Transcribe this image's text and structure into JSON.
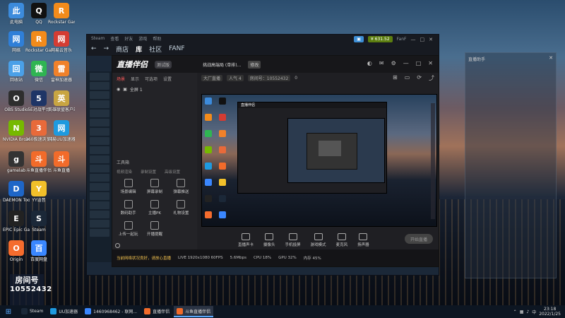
{
  "desktop": {
    "icons": [
      {
        "label": "此电脑",
        "color": "#3c8bdc"
      },
      {
        "label": "QQ",
        "color": "#111111"
      },
      {
        "label": "Rockstar Games Launcher",
        "color": "#f28b1b"
      },
      {
        "label": "网络",
        "color": "#2f7fd8"
      },
      {
        "label": "Rockstar Games Social Club",
        "color": "#f28b1b"
      },
      {
        "label": "网易云音乐",
        "color": "#d43c33"
      },
      {
        "label": "回收站",
        "color": "#4aa0e8"
      },
      {
        "label": "微信",
        "color": "#2fb552"
      },
      {
        "label": "雷神加速器",
        "color": "#f0812a"
      },
      {
        "label": "OBS Studio",
        "color": "#2e2e2e"
      },
      {
        "label": "5E对战平台",
        "color": "#1e3566"
      },
      {
        "label": "英雄联盟客户端",
        "color": "#c8a542"
      },
      {
        "label": "NVIDIA Broadcast",
        "color": "#76b900"
      },
      {
        "label": "360极速浏览器",
        "color": "#e86a3a"
      },
      {
        "label": "网易UU加速器",
        "color": "#1e9adf"
      },
      {
        "label": "gamelab",
        "color": "#333333"
      },
      {
        "label": "斗鱼直播伴侣",
        "color": "#f26b2a"
      },
      {
        "label": "斗鱼直播",
        "color": "#f26b2a"
      },
      {
        "label": "DAEMON Tools Lite",
        "color": "#1e66c8"
      },
      {
        "label": "YY语音",
        "color": "#f2c02a"
      },
      {
        "label": "EPIC Epic Games Launcher",
        "color": "#222222"
      },
      {
        "label": "Steam",
        "color": "#1b2838"
      },
      {
        "label": "Origin",
        "color": "#f56c2d"
      },
      {
        "label": "百度网盘",
        "color": "#3a87ff"
      }
    ],
    "room_badge": {
      "line1": "房间号",
      "line2": "10552432"
    }
  },
  "steam": {
    "menu": [
      "Steam",
      "查看",
      "好友",
      "游戏",
      "帮助"
    ],
    "nav": [
      "商店",
      "库",
      "社区",
      "FANF"
    ],
    "active_nav": "库",
    "user": "FanF",
    "balance": "¥ 631.52"
  },
  "live_app": {
    "logo": "直播伴侣",
    "version": "测试版",
    "stream_title": "挑战高端局 (单排)...",
    "title_tag": "修改",
    "info_chips": [
      "大厂直播",
      "人气 4",
      "房间号：10552432",
      "0"
    ],
    "tabs": [
      "场景",
      "显示",
      "可选项",
      "设置"
    ],
    "scene": "全屏 1",
    "tools_label": "工具箱",
    "tools_row": [
      "视频渲染",
      "录制设置",
      "高级设置"
    ],
    "tools": [
      "场景编辑",
      "屏幕录制",
      "弹幕推送",
      "数码助手",
      "主播PK",
      "礼物设置",
      "上传一起玩",
      "开播提醒",
      ""
    ],
    "bottom_buttons": [
      "直播声卡",
      "摄像头",
      "手机投屏",
      "游戏模式",
      "麦克风",
      "扬声器"
    ],
    "start_button": "开始直播",
    "status_items": [
      "LIVE 1920x1080 60FPS",
      "5.6Mbps",
      "CPU 18%",
      "GPU 32%",
      "内存 45%"
    ],
    "status_warn": "当前网络状况良好，请放心直播"
  },
  "right_panel": {
    "title": "直播助手"
  },
  "taskbar": {
    "items": [
      {
        "label": "Steam",
        "color": "#1b2838"
      },
      {
        "label": "UU加速器",
        "color": "#1e9adf"
      },
      {
        "label": "1460968462 - 联网...",
        "color": "#3a87ff"
      },
      {
        "label": "直播伴侣",
        "color": "#f26b2a"
      },
      {
        "label": "斗鱼直播伴侣",
        "color": "#f26b2a"
      }
    ],
    "time": "23:18",
    "date": "2022/1/25"
  }
}
